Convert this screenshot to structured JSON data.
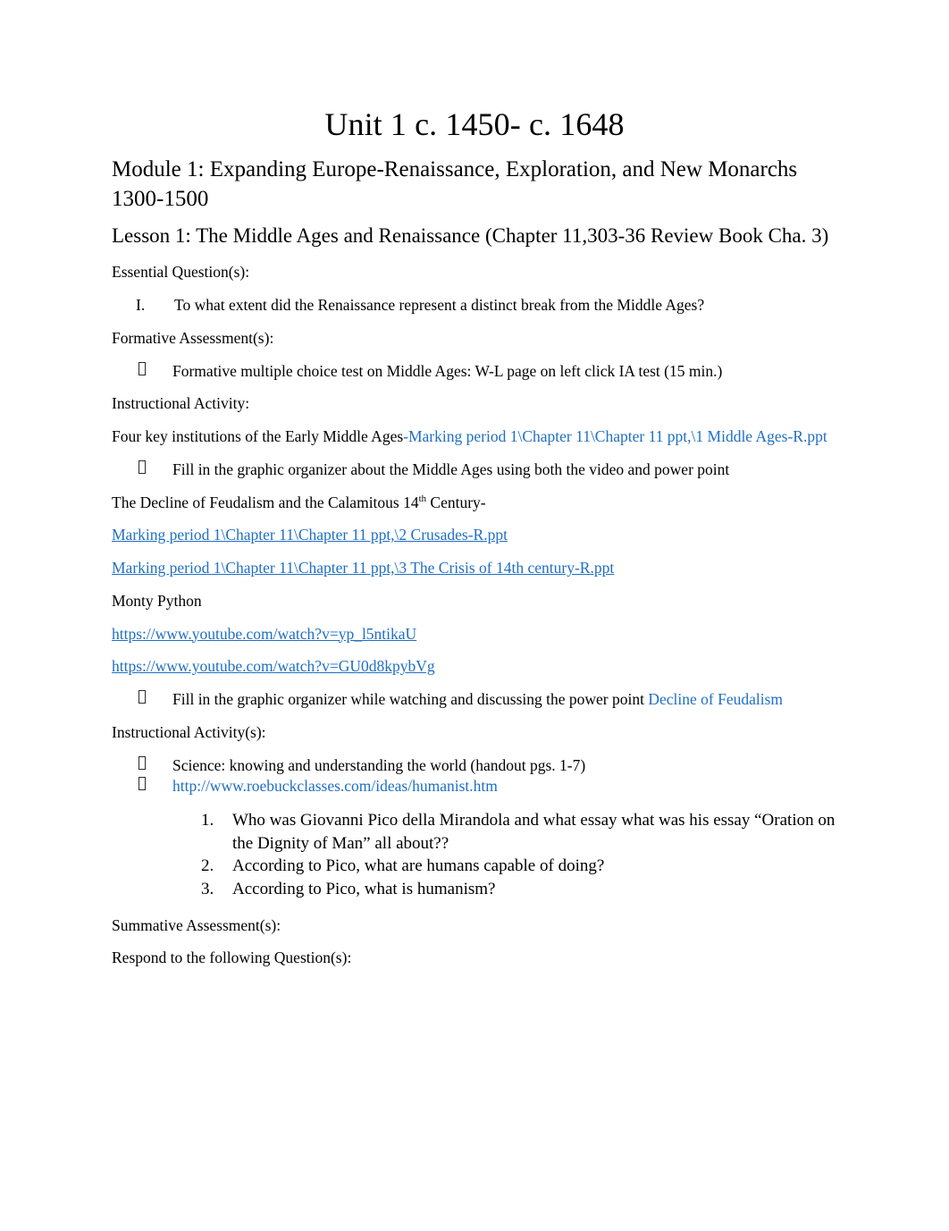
{
  "document": {
    "title": "Unit 1 c. 1450- c. 1648",
    "module_heading": "Module 1: Expanding Europe-Renaissance, Exploration, and New Monarchs 1300-1500",
    "lesson_heading": "Lesson 1: The Middle Ages and Renaissance (Chapter 11,303-36 Review Book Cha. 3)"
  },
  "colors": {
    "link": "#1f6fc4",
    "text": "#000000",
    "page_background": "#ffffff"
  },
  "sections": {
    "essential_question": {
      "label": "Essential Question(s):",
      "items": [
        {
          "marker": "I.",
          "text": "To what extent did the Renaissance represent a distinct break from the Middle Ages?"
        }
      ]
    },
    "formative_assessment": {
      "label": "Formative Assessment(s):",
      "items": [
        {
          "bullet": "square-box-bullet",
          "text": "Formative multiple choice test on Middle Ages: W-L page on left click IA test (15 min.)"
        }
      ]
    },
    "instructional_activity": {
      "label": "Instructional Activity:",
      "lead_text": "Four key institutions of the Early Middle Ages",
      "lead_separator": "-",
      "lead_link": "Marking period 1\\Chapter 11\\Chapter 11 ppt,\\1 Middle Ages-R.ppt",
      "bullets_1": [
        {
          "bullet": "square-box-bullet",
          "text": "Fill in the graphic organizer about the Middle Ages using both the video and power point"
        }
      ],
      "decline_heading_pre": "The Decline of Feudalism and the Calamitous 14",
      "decline_heading_sup": "th",
      "decline_heading_post": " Century-",
      "links": [
        "Marking period 1\\Chapter 11\\Chapter 11 ppt,\\2 Crusades-R.ppt",
        "Marking period 1\\Chapter 11\\Chapter 11 ppt,\\3 The Crisis of 14th century-R.ppt"
      ],
      "monty_python_label": "Monty Python",
      "video_links": [
        "https://www.youtube.com/watch?v=yp_l5ntikaU",
        "https://www.youtube.com/watch?v=GU0d8kpybVg"
      ],
      "bullets_2": [
        {
          "bullet": "square-box-bullet",
          "text": "Fill in the graphic organizer while watching and discussing the power point ",
          "link_text": "Decline of Feudalism"
        }
      ]
    },
    "instructional_activities": {
      "label": "Instructional Activity(s):",
      "bullets": [
        {
          "bullet": "square-box-bullet",
          "text": "Science: knowing and understanding the world (handout pgs. 1-7)",
          "is_link": false
        },
        {
          "bullet": "square-box-bullet",
          "text": "http://www.roebuckclasses.com/ideas/humanist.htm",
          "is_link": true
        }
      ],
      "questions": [
        {
          "marker": "1.",
          "text": "Who was Giovanni Pico della Mirandola and what essay what was his essay “Oration on the Dignity of Man” all about??"
        },
        {
          "marker": "2.",
          "text": "According to Pico, what are humans capable of doing?"
        },
        {
          "marker": "3.",
          "text": "According to Pico, what is humanism?"
        }
      ]
    },
    "summative_assessment": {
      "label": "Summative Assessment(s):",
      "respond_label": "Respond to the following Question(s):"
    }
  }
}
